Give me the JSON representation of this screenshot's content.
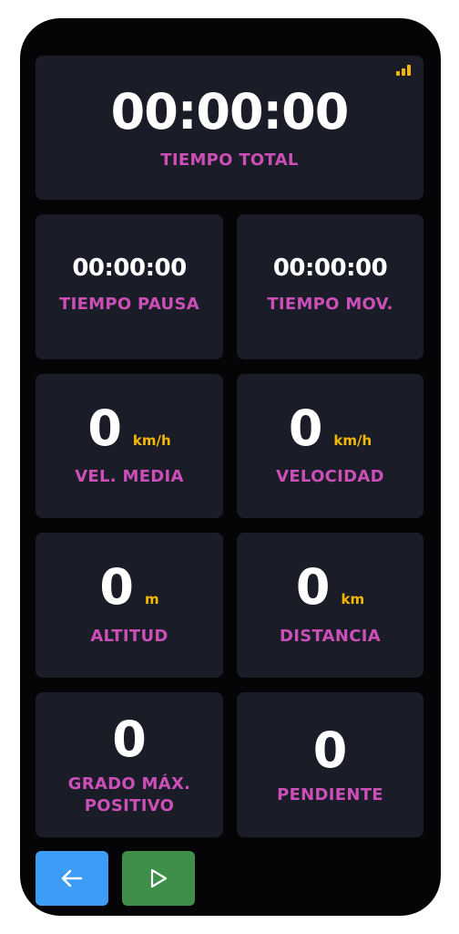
{
  "total_time": {
    "value": "00:00:00",
    "label": "TIEMPO TOTAL"
  },
  "signal_icon": "signal-bars-icon",
  "pause_time": {
    "value": "00:00:00",
    "label": "TIEMPO PAUSA"
  },
  "moving_time": {
    "value": "00:00:00",
    "label": "TIEMPO MOV."
  },
  "avg_speed": {
    "value": "0",
    "unit": "km/h",
    "label": "VEL. MEDIA"
  },
  "speed": {
    "value": "0",
    "unit": "km/h",
    "label": "VELOCIDAD"
  },
  "altitude": {
    "value": "0",
    "unit": "m",
    "label": "ALTITUD"
  },
  "distance": {
    "value": "0",
    "unit": "km",
    "label": "DISTANCIA"
  },
  "max_grade": {
    "value": "0",
    "label": "GRADO MÁX. POSITIVO"
  },
  "slope": {
    "value": "0",
    "label": "PENDIENTE"
  },
  "buttons": {
    "back_icon": "arrow-left-icon",
    "play_icon": "play-icon"
  },
  "colors": {
    "background": "#050507",
    "card": "#1a1c28",
    "label": "#cc4fb8",
    "unit": "#f5b800",
    "back_button": "#3d9cf5",
    "play_button": "#3f8f48"
  }
}
